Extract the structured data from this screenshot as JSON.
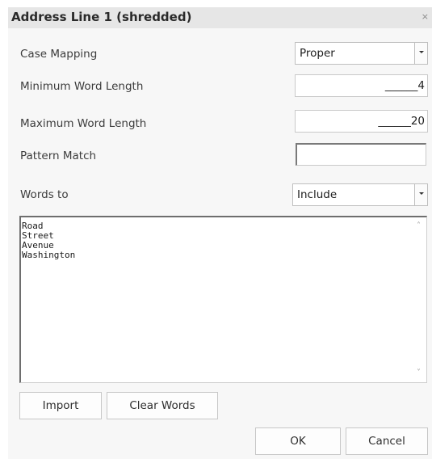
{
  "dialog": {
    "title": "Address Line 1 (shredded)",
    "close_glyph": "×"
  },
  "fields": {
    "case_mapping": {
      "label": "Case Mapping",
      "value": "Proper"
    },
    "min_word_length": {
      "label": "Minimum Word Length",
      "value": "______4"
    },
    "max_word_length": {
      "label": "Maximum Word Length",
      "value": "______20"
    },
    "pattern_match": {
      "label": "Pattern Match",
      "value": ""
    },
    "words_to": {
      "label": "Words to",
      "value": "Include"
    }
  },
  "word_list": {
    "lines": [
      "Road",
      "Street",
      "Avenue",
      "Washington"
    ]
  },
  "buttons": {
    "import": "Import",
    "clear_words": "Clear Words",
    "ok": "OK",
    "cancel": "Cancel"
  },
  "icons": {
    "close": "close-icon",
    "dropdown": "chevron-down-icon",
    "scroll_up": "scroll-up-arrow-icon",
    "scroll_down": "scroll-down-arrow-icon"
  }
}
